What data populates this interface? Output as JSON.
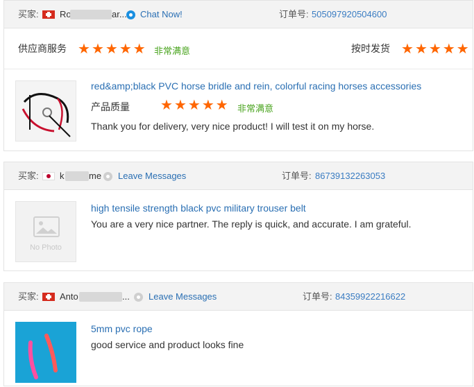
{
  "labels": {
    "buyer": "买家:",
    "order": "订单号:",
    "supplier_service": "供应商服务",
    "on_time_delivery": "按时发货",
    "product_quality": "产品质量",
    "very_satisfied": "非常满意"
  },
  "reviews": [
    {
      "buyer_flag": "switzerland-flag",
      "buyer_prefix": "Ro",
      "buyer_suffix": "ar...",
      "contact": "Chat Now!",
      "order_no": "505097920504600",
      "product": "red&amp;black PVC horse bridle and rein, colorful racing horses accessories",
      "comment": "Thank you for delivery, very nice product! I will test it on my horse.",
      "supplier_service_stars": 5,
      "delivery_stars": 5,
      "quality_stars": 5
    },
    {
      "buyer_flag": "japan-flag",
      "buyer_prefix": "k",
      "buyer_suffix": "me",
      "contact": "Leave Messages",
      "order_no": "86739132263053",
      "product": "high tensile strength black pvc military trouser belt",
      "comment": "You are a very nice partner. The reply is quick, and accurate. I am grateful.",
      "no_photo": "No Photo"
    },
    {
      "buyer_flag": "switzerland-flag",
      "buyer_prefix": "Anto",
      "buyer_suffix": "...",
      "contact": "Leave Messages",
      "order_no": "84359922216622",
      "product": "5mm pvc rope",
      "comment": "good service and product looks fine"
    }
  ],
  "colors": {
    "link": "#2a6fb3",
    "star": "#ff6600",
    "satisfied": "#4aa41f",
    "header_bg": "#f3f3f3"
  }
}
